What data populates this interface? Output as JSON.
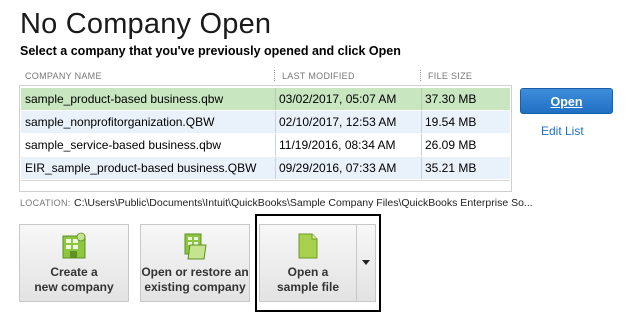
{
  "header": {
    "title": "No Company Open",
    "subtitle": "Select a company that you've previously opened and click Open"
  },
  "table": {
    "columns": [
      "COMPANY NAME",
      "LAST MODIFIED",
      "FILE SIZE"
    ],
    "rows": [
      {
        "name": "sample_product-based business.qbw",
        "modified": "03/02/2017, 05:07 AM",
        "size": "37.30 MB",
        "selected": true
      },
      {
        "name": "sample_nonprofitorganization.QBW",
        "modified": "02/10/2017, 12:53 AM",
        "size": "19.54 MB",
        "selected": false
      },
      {
        "name": "sample_service-based business.qbw",
        "modified": "11/19/2016, 08:34 AM",
        "size": "26.09 MB",
        "selected": false
      },
      {
        "name": "EIR_sample_product-based business.QBW",
        "modified": "09/29/2016, 07:33 AM",
        "size": "35.21 MB",
        "selected": false
      }
    ]
  },
  "actions": {
    "open_label": "Open",
    "edit_list_label": "Edit List"
  },
  "location": {
    "label": "LOCATION:",
    "value": "C:\\Users\\Public\\Documents\\Intuit\\QuickBooks\\Sample Company Files\\QuickBooks Enterprise So..."
  },
  "buttons": {
    "create": {
      "label": "Create a\nnew company",
      "icon": "new-company-icon"
    },
    "open_restore": {
      "label": "Open or restore an\nexisting company",
      "icon": "open-folder-icon"
    },
    "sample": {
      "label": "Open a\nsample file",
      "icon": "sample-file-icon"
    }
  },
  "colors": {
    "accent": "#1f6fc4",
    "selected_row": "#c8e6c0",
    "icon_green": "#8dc63f"
  }
}
